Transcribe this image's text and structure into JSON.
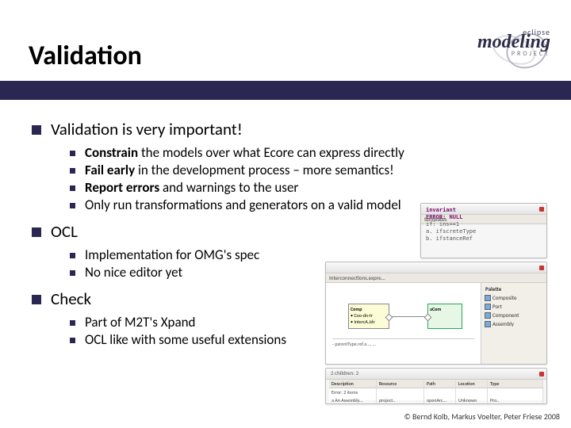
{
  "header": {
    "title": "Validation"
  },
  "logo": {
    "eclipse": "eclipse",
    "main": "modeling",
    "project": "PROJECT"
  },
  "s1": {
    "title": "Validation is very important!",
    "i1a": "Constrain",
    "i1b": " the models over what Ecore can express directly",
    "i2a": "Fail early",
    "i2b": " in the development process – more semantics!",
    "i3a": "Report errors",
    "i3b": " and warnings to the user",
    "i4": "Only run transformations and generators on a valid model"
  },
  "s2": {
    "title": "OCL",
    "i1": "Implementation for OMG's spec",
    "i2": "No nice editor yet"
  },
  "s3": {
    "title": "Check",
    "i1": "Part of M2T's Xpand",
    "i2": "OCL like with some useful extensions"
  },
  "thumb1": {
    "tab": "templates",
    "l1": "invariant",
    "l2": "ERROR: NULL",
    "l3": "  if: ins==1",
    "l4": "  a. ifscreteType",
    "l5": "  b. ifstanceRef"
  },
  "thumb2": {
    "tab": "Interconnections.expre...",
    "pal_title": "Palette",
    "pal": {
      "p1": "Composite",
      "p2": "Port",
      "p3": "Component",
      "p4": "Assembly"
    },
    "box1_t": "Comp",
    "box1_l1": "• Coo-dn-tr",
    "box1_l2": "• IntercA.Jdr",
    "box2_t": "aCom",
    "sub": "- parentType.ref.a..., ..."
  },
  "thumb3": {
    "tab": "2 children: 2",
    "h": {
      "c1": "Description",
      "c2": "Resource",
      "c3": "Path",
      "c4": "Location",
      "c5": "Type"
    },
    "r1": {
      "c1": "Error: 2 items",
      "c2": "",
      "c3": "",
      "c4": "",
      "c5": ""
    },
    "r2": {
      "c1": "a An Assembly...",
      "c2": "project..",
      "c3": "openArc...",
      "c4": "Unknown",
      "c5": "Pro.."
    }
  },
  "footer": "© Bernd Kolb, Markus Voelter, Peter Friese 2008"
}
